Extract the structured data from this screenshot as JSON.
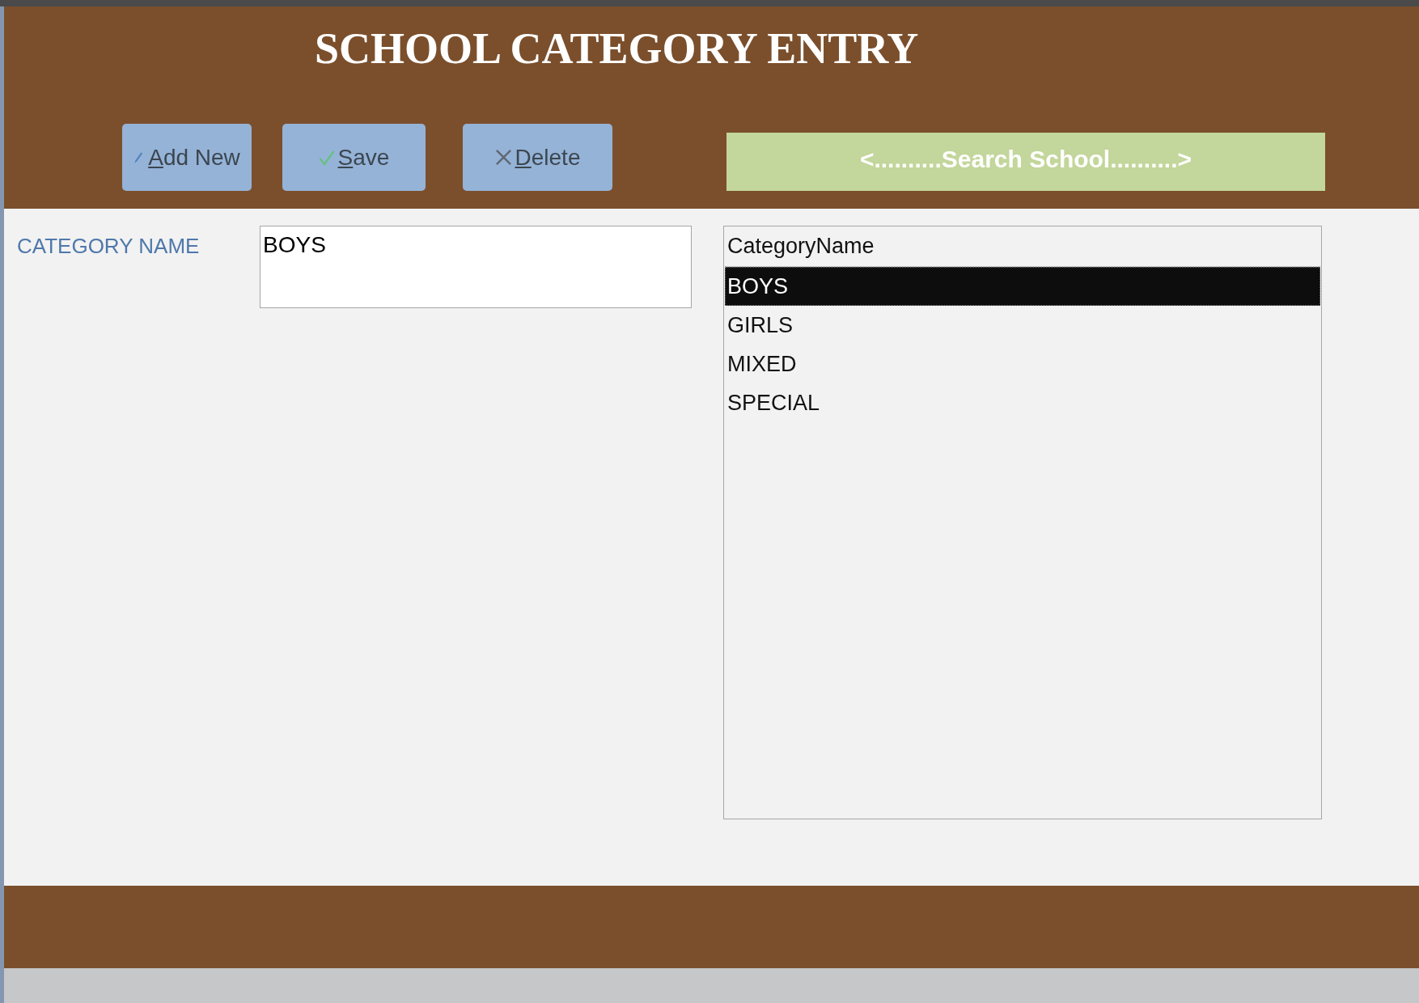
{
  "window": {
    "title": "SCHOOL CATEGORY ENTRY"
  },
  "toolbar": {
    "buttons": [
      {
        "label": "Add New",
        "kind": "add"
      },
      {
        "label": "Save",
        "kind": "save"
      },
      {
        "label": "Delete",
        "kind": "delete"
      }
    ],
    "search_button": {
      "label": "<..........Search School..........>"
    }
  },
  "form": {
    "fields": [
      {
        "label": "CATEGORY NAME",
        "value": "BOYS"
      }
    ]
  },
  "list": {
    "columns": [
      "CategoryName"
    ],
    "rows": [
      {
        "category_name": "BOYS",
        "selected": true
      },
      {
        "category_name": "GIRLS",
        "selected": false
      },
      {
        "category_name": "MIXED",
        "selected": false
      },
      {
        "category_name": "SPECIAL",
        "selected": false
      }
    ]
  }
}
